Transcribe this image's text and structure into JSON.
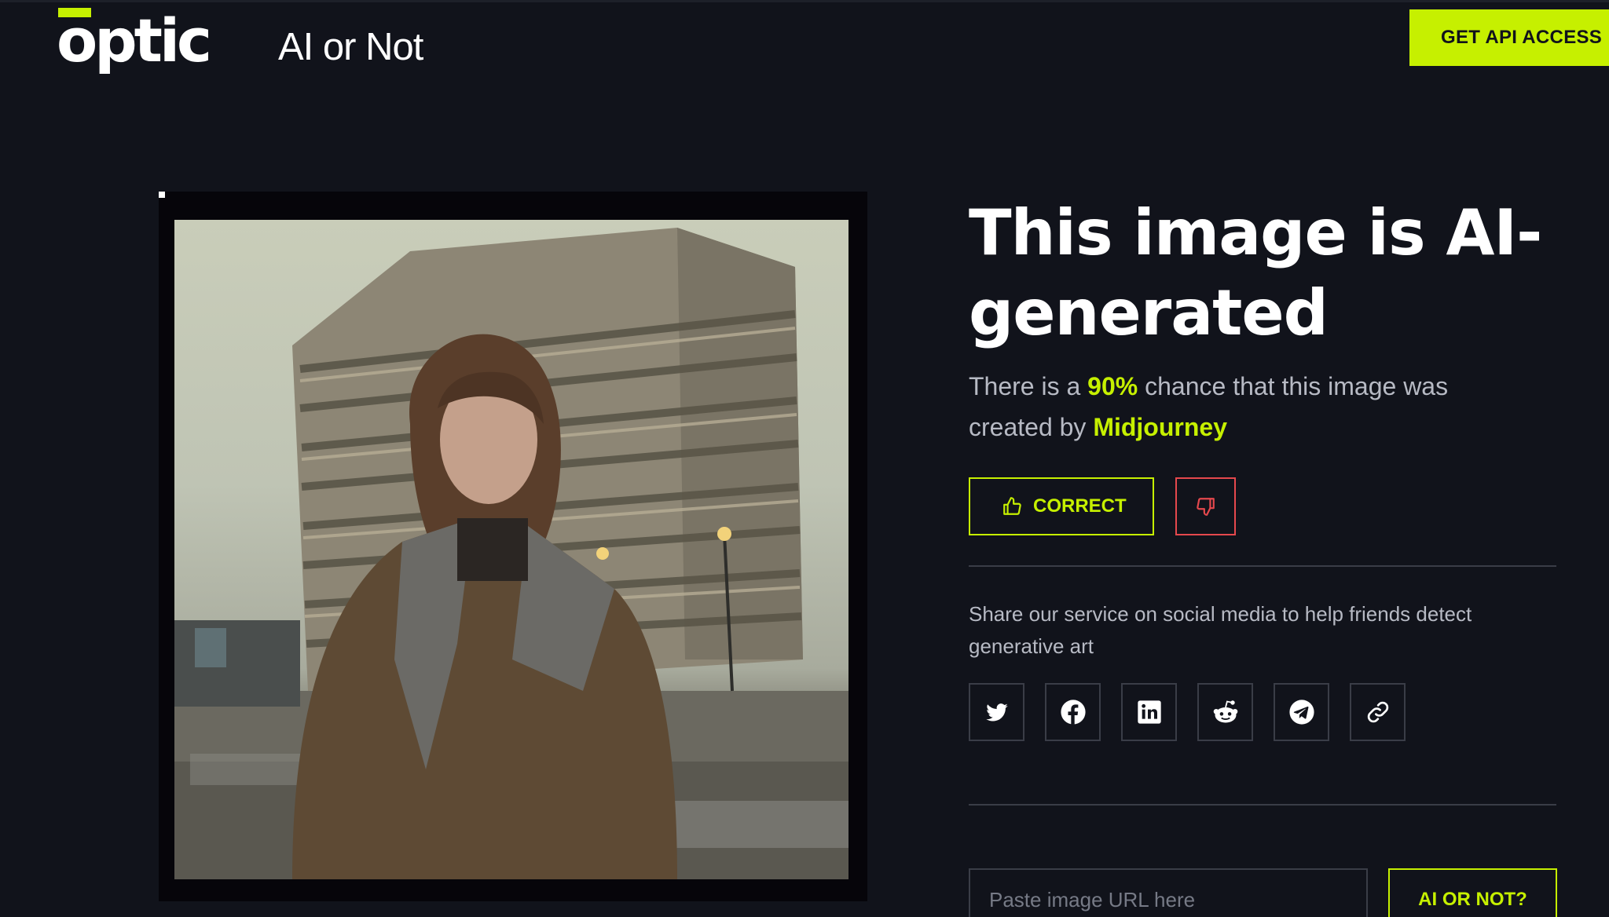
{
  "header": {
    "logo_text": "optic",
    "logo_subtitle": "AI or Not",
    "api_button_label": "GET API ACCESS"
  },
  "result": {
    "headline": "This image is AI-generated",
    "desc_prefix": "There is a ",
    "probability": "90%",
    "desc_middle": " chance that this image was created by ",
    "generator": "Midjourney",
    "correct_label": "CORRECT"
  },
  "share": {
    "text": "Share our service on social media to help friends detect generative art",
    "icons": [
      "twitter-icon",
      "facebook-icon",
      "linkedin-icon",
      "reddit-icon",
      "telegram-icon",
      "link-icon"
    ]
  },
  "check": {
    "url_placeholder": "Paste image URL here",
    "submit_label": "AI OR NOT?"
  },
  "colors": {
    "background": "#11131b",
    "accent": "#c6f000",
    "negative": "#e5484d",
    "muted_text": "#b7bac4",
    "border": "#3a3d47"
  }
}
